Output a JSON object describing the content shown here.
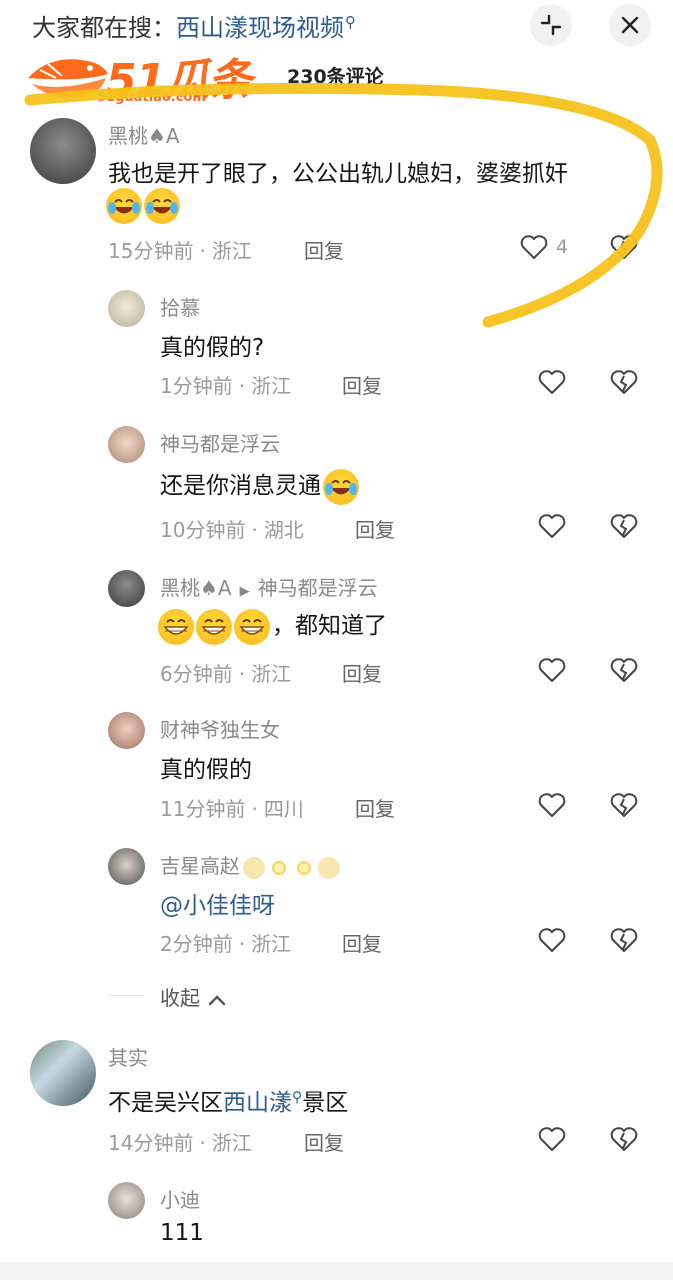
{
  "header": {
    "search_prefix": "大家都在搜：",
    "search_keyword": "西山漾现场视频",
    "comment_count": "230条评论",
    "logo_text": "51瓜条",
    "logo_url": "51guatiao.com"
  },
  "comments": [
    {
      "username": "黑桃♠A",
      "text": "我也是开了眼了，公公出轨儿媳妇，婆婆抓奸",
      "time": "15分钟前",
      "location": "浙江",
      "reply": "回复",
      "likes": "4"
    },
    {
      "username": "拾慕",
      "text": "真的假的?",
      "time": "1分钟前",
      "location": "浙江",
      "reply": "回复"
    },
    {
      "username": "神马都是浮云",
      "text": "还是你消息灵通",
      "time": "10分钟前",
      "location": "湖北",
      "reply": "回复"
    },
    {
      "username": "黑桃♠A",
      "reply_to": "神马都是浮云",
      "text": "，都知道了",
      "time": "6分钟前",
      "location": "浙江",
      "reply": "回复"
    },
    {
      "username": "财神爷独生女",
      "text": "真的假的",
      "time": "11分钟前",
      "location": "四川",
      "reply": "回复"
    },
    {
      "username": "吉星高赵",
      "text": "@小佳佳呀",
      "time": "2分钟前",
      "location": "浙江",
      "reply": "回复"
    },
    {
      "username": "其实",
      "text_before": "不是吴兴区",
      "text_keyword": "西山漾",
      "text_after": "景区",
      "time": "14分钟前",
      "location": "浙江",
      "reply": "回复"
    },
    {
      "username": "小迪",
      "text": "111"
    }
  ],
  "collapse_label": "收起",
  "colors": {
    "link_blue": "#2f5c8f",
    "logo_orange": "#ff6a1c",
    "marker_yellow": "#f5c21b"
  }
}
